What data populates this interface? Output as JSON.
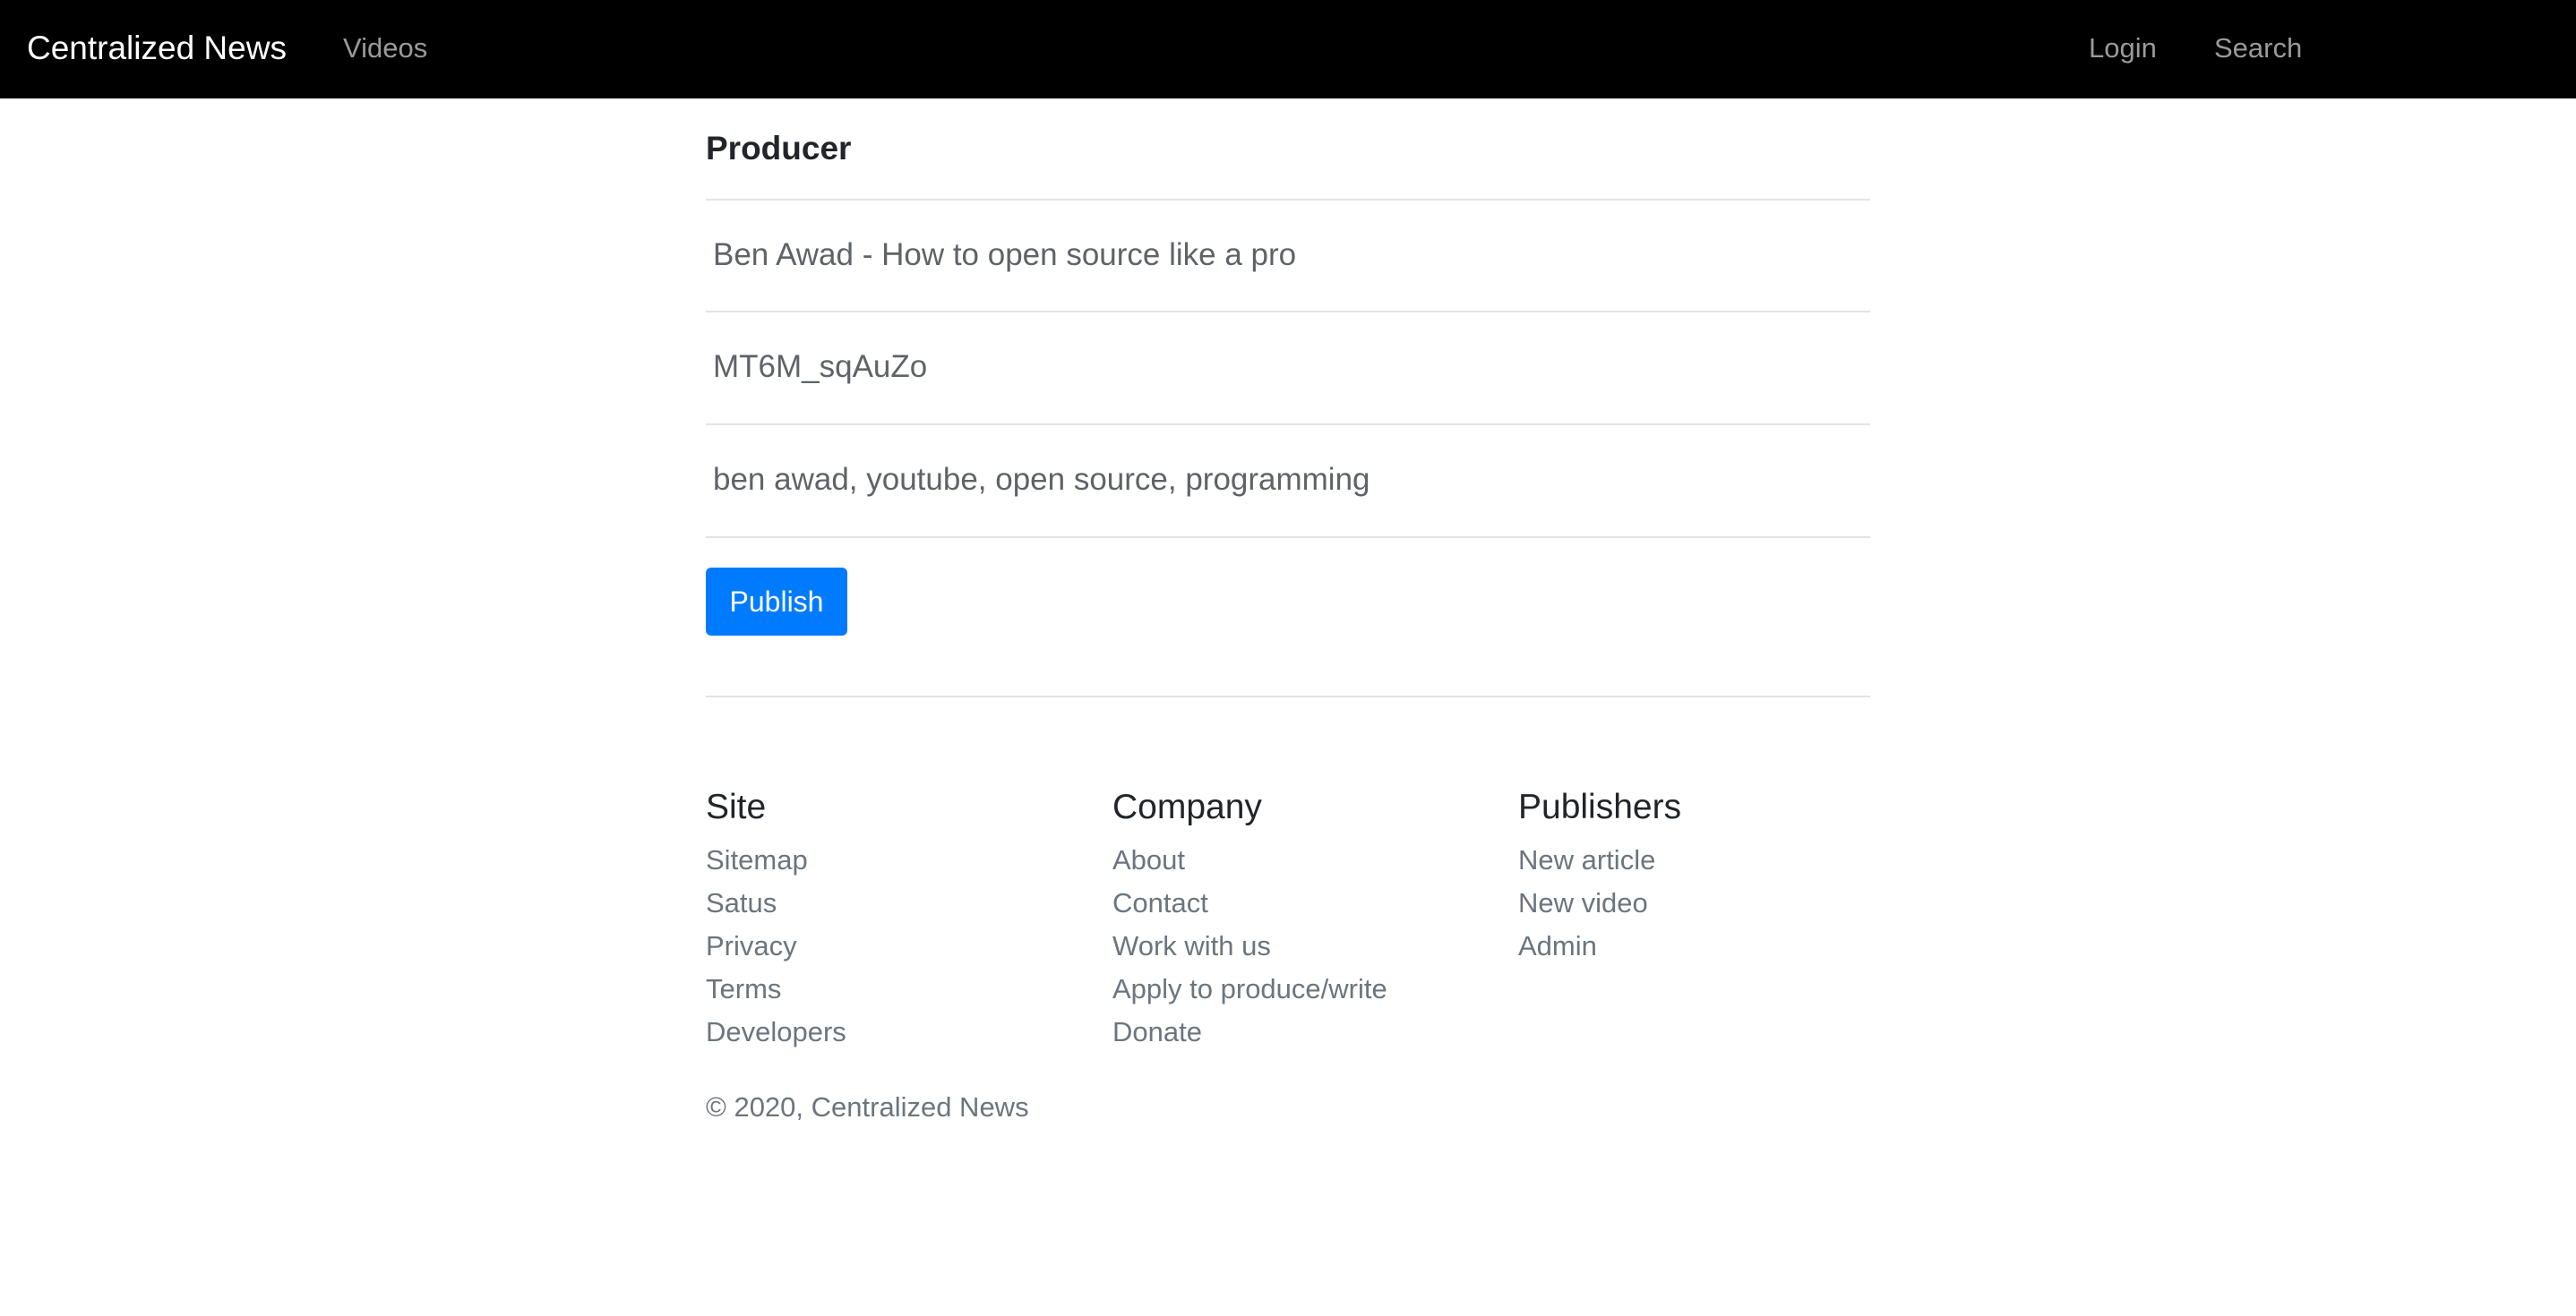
{
  "navbar": {
    "brand": "Centralized News",
    "links": {
      "videos": "Videos",
      "login": "Login",
      "search": "Search"
    }
  },
  "form": {
    "section_title": "Producer",
    "fields": {
      "title": "Ben Awad - How to open source like a pro",
      "video_id": "MT6M_sqAuZo",
      "tags": "ben awad, youtube, open source, programming"
    },
    "publish_label": "Publish",
    "accent_color": "#007bff"
  },
  "footer": {
    "columns": [
      {
        "heading": "Site",
        "links": [
          "Sitemap",
          "Satus",
          "Privacy",
          "Terms",
          "Developers"
        ]
      },
      {
        "heading": "Company",
        "links": [
          "About",
          "Contact",
          "Work with us",
          "Apply to produce/write",
          "Donate"
        ]
      },
      {
        "heading": "Publishers",
        "links": [
          "New article",
          "New video",
          "Admin"
        ]
      }
    ],
    "copyright": "© 2020, Centralized News"
  }
}
